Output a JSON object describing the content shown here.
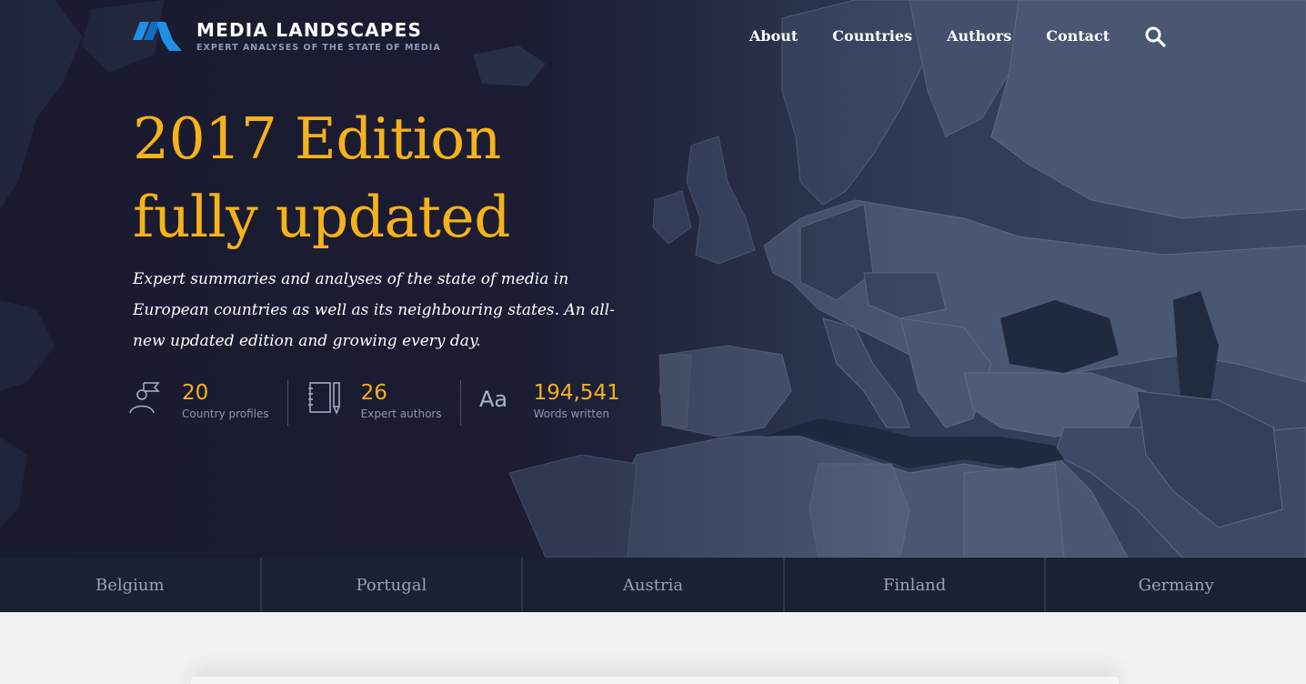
{
  "brand": {
    "title": "MEDIA LANDSCAPES",
    "subtitle": "EXPERT ANALYSES OF THE STATE OF MEDIA",
    "accent": "#1e90e6"
  },
  "nav": {
    "items": [
      "About",
      "Countries",
      "Authors",
      "Contact"
    ],
    "search_icon": "search-icon"
  },
  "hero": {
    "headline_line1": "2017 Edition",
    "headline_line2": "fully updated",
    "lede": "Expert summaries and analyses of the state of media in European countries as well as its neighbouring states. An all-new updated edition and growing every day.",
    "accent_color": "#f6b21b"
  },
  "stats": [
    {
      "icon": "flag-person-icon",
      "value": "20",
      "label": "Country profiles"
    },
    {
      "icon": "notebook-pencil-icon",
      "value": "26",
      "label": "Expert authors"
    },
    {
      "icon": "font-aa-icon",
      "value": "194,541",
      "label": "Words written"
    }
  ],
  "countries": [
    "Belgium",
    "Portugal",
    "Austria",
    "Finland",
    "Germany"
  ]
}
